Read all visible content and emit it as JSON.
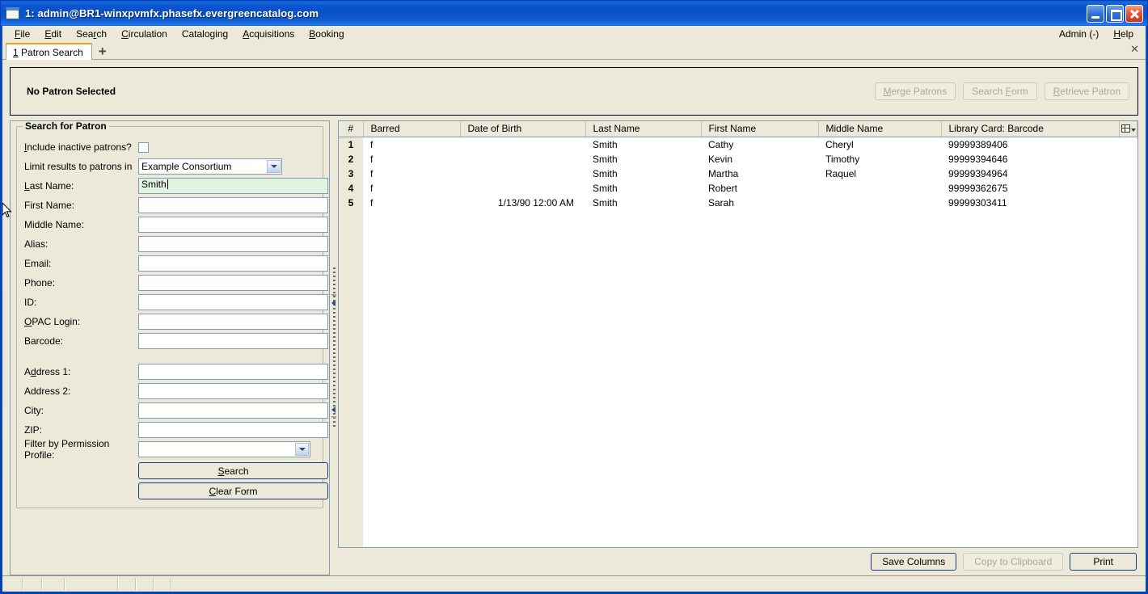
{
  "window": {
    "title": "1: admin@BR1-winxpvmfx.phasefx.evergreencatalog.com",
    "icon": "window-icon",
    "minimize_label": "Minimize",
    "maximize_label": "Maximize",
    "close_label": "Close"
  },
  "menubar": {
    "items": [
      {
        "label": "File",
        "accel": "F"
      },
      {
        "label": "Edit",
        "accel": "E"
      },
      {
        "label": "Search",
        "accel": "r"
      },
      {
        "label": "Circulation",
        "accel": "C"
      },
      {
        "label": "Cataloging",
        "accel": "g"
      },
      {
        "label": "Acquisitions",
        "accel": "A"
      },
      {
        "label": "Booking",
        "accel": "B"
      }
    ],
    "right": [
      {
        "label": "Admin (-)",
        "accel": ""
      },
      {
        "label": "Help",
        "accel": "H"
      }
    ]
  },
  "tabs": {
    "active": {
      "index": "1",
      "label": "Patron Search"
    },
    "new_tab_icon": "plus-icon",
    "close_icon": "close-icon",
    "close_glyph": "✕"
  },
  "patron_bar": {
    "status": "No Patron Selected",
    "buttons": [
      {
        "label": "Merge Patrons",
        "accel": "M",
        "enabled": false
      },
      {
        "label": "Search Form",
        "accel": "F",
        "enabled": false
      },
      {
        "label": "Retrieve Patron",
        "accel": "R",
        "enabled": false
      }
    ]
  },
  "search_form": {
    "legend": "Search for Patron",
    "fields": [
      {
        "label": "Include inactive patrons?",
        "accel": "n",
        "type": "checkbox",
        "value": "",
        "checked": false
      },
      {
        "label": "Limit results to patrons in",
        "accel": "",
        "type": "select",
        "value": "Example Consortium"
      },
      {
        "label": "Last Name:",
        "accel": "L",
        "type": "text",
        "value": "Smith",
        "focused": true
      },
      {
        "label": "First Name:",
        "accel": "",
        "type": "text",
        "value": ""
      },
      {
        "label": "Middle Name:",
        "accel": "",
        "type": "text",
        "value": ""
      },
      {
        "label": "Alias:",
        "accel": "",
        "type": "text",
        "value": ""
      },
      {
        "label": "Email:",
        "accel": "",
        "type": "text",
        "value": ""
      },
      {
        "label": "Phone:",
        "accel": "",
        "type": "text",
        "value": ""
      },
      {
        "label": "ID:",
        "accel": "",
        "type": "text",
        "value": ""
      },
      {
        "label": "OPAC Login:",
        "accel": "O",
        "type": "text",
        "value": ""
      },
      {
        "label": "Barcode:",
        "accel": "",
        "type": "text",
        "value": ""
      },
      {
        "label": "Address 1:",
        "accel": "d",
        "type": "text",
        "value": ""
      },
      {
        "label": "Address 2:",
        "accel": "",
        "type": "text",
        "value": ""
      },
      {
        "label": "City:",
        "accel": "",
        "type": "text",
        "value": ""
      },
      {
        "label": "ZIP:",
        "accel": "",
        "type": "text",
        "value": ""
      },
      {
        "label": "Filter by Permission Profile:",
        "accel": "",
        "type": "select",
        "value": ""
      }
    ],
    "search_button": {
      "label": "Search",
      "accel": "S"
    },
    "clear_button": {
      "label": "Clear Form",
      "accel": "C"
    }
  },
  "results": {
    "columns": [
      {
        "key": "num",
        "label": "#"
      },
      {
        "key": "barred",
        "label": "Barred"
      },
      {
        "key": "dob",
        "label": "Date of Birth"
      },
      {
        "key": "last",
        "label": "Last Name"
      },
      {
        "key": "first",
        "label": "First Name"
      },
      {
        "key": "middle",
        "label": "Middle Name"
      },
      {
        "key": "barcode",
        "label": "Library Card: Barcode"
      }
    ],
    "column_picker_icon": "column-picker-icon",
    "rows": [
      {
        "num": "1",
        "barred": "f",
        "dob": "",
        "last": "Smith",
        "first": "Cathy",
        "middle": "Cheryl",
        "barcode": "99999389406"
      },
      {
        "num": "2",
        "barred": "f",
        "dob": "",
        "last": "Smith",
        "first": "Kevin",
        "middle": "Timothy",
        "barcode": "99999394646"
      },
      {
        "num": "3",
        "barred": "f",
        "dob": "",
        "last": "Smith",
        "first": "Martha",
        "middle": "Raquel",
        "barcode": "99999394964"
      },
      {
        "num": "4",
        "barred": "f",
        "dob": "",
        "last": "Smith",
        "first": "Robert",
        "middle": "",
        "barcode": "99999362675"
      },
      {
        "num": "5",
        "barred": "f",
        "dob": "1/13/90 12:00 AM",
        "last": "Smith",
        "first": "Sarah",
        "middle": "",
        "barcode": "99999303411"
      }
    ],
    "buttons": [
      {
        "label": "Save Columns",
        "enabled": true
      },
      {
        "label": "Copy to Clipboard",
        "enabled": false
      },
      {
        "label": "Print",
        "enabled": true
      }
    ]
  },
  "statusbar": {
    "cells": [
      "",
      "",
      "",
      "",
      "",
      "",
      "",
      ""
    ]
  },
  "colors": {
    "titlebar_blue": "#0a52c8",
    "face": "#ece9d8",
    "field_border": "#7f9db9",
    "focused_field_bg": "#e2f3e0",
    "tab_accent": "#f3a017",
    "disabled_text": "#aca899"
  }
}
